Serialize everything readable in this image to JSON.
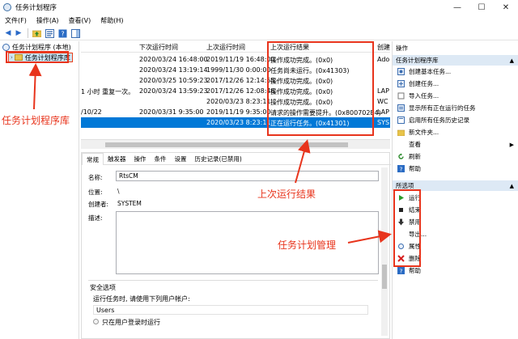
{
  "window": {
    "title": "任务计划程序",
    "controls": [
      "—",
      "☐",
      "✕"
    ]
  },
  "menu": [
    "文件(F)",
    "操作(A)",
    "查看(V)",
    "帮助(H)"
  ],
  "tree": {
    "root": "任务计划程序 (本地)",
    "child": "任务计划程序库"
  },
  "list": {
    "headers": {
      "next_run": "下次运行时间",
      "last_run": "上次运行时间",
      "last_result": "上次运行结果",
      "creator": "创建"
    },
    "rows": [
      {
        "name": "",
        "next_run": "2020/03/24 16:48:00",
        "last_run": "2019/11/19 16:48:00",
        "result": "操作成功完成。(0x0)",
        "creator": "Ado"
      },
      {
        "name": "",
        "next_run": "2020/03/24 13:19:14",
        "last_run": "1999/11/30 0:00:00",
        "result": "任务尚未运行。(0x41303)",
        "creator": ""
      },
      {
        "name": "",
        "next_run": "2020/03/25 10:59:23",
        "last_run": "2017/12/26 12:14:55",
        "result": "操作成功完成。(0x0)",
        "creator": ""
      },
      {
        "name": "1 小时 重复一次。",
        "next_run": "2020/03/24 13:59:23",
        "last_run": "2017/12/26 12:08:46",
        "result": "操作成功完成。(0x0)",
        "creator": "LAP"
      },
      {
        "name": "",
        "next_run": "",
        "last_run": "2020/03/23 8:23:11",
        "result": "操作成功完成。(0x0)",
        "creator": "WC"
      },
      {
        "name": "/10/22",
        "next_run": "2020/03/31 9:35:00",
        "last_run": "2019/11/19 9:35:00",
        "result": "请求的操作需要提升。(0x800702E4)",
        "creator": "LAP"
      },
      {
        "name": "",
        "next_run": "",
        "last_run": "2020/03/23 8:23:11",
        "result": "正在运行任务。(0x41301)",
        "creator": "SYS"
      }
    ],
    "selected_row_index": 6
  },
  "detail": {
    "tabs": [
      "常规",
      "触发器",
      "操作",
      "条件",
      "设置",
      "历史记录(已禁用)"
    ],
    "name_label": "名称:",
    "name_value": "RtsCM",
    "location_label": "位置:",
    "location_value": "\\",
    "author_label": "创建者:",
    "author_value": "SYSTEM",
    "description_label": "描述:",
    "security_title": "安全选项",
    "security_run_as": "运行任务时, 请使用下列用户帐户:",
    "security_user": "Users",
    "security_option": "只在用户登录时运行"
  },
  "actions": {
    "header": "操作",
    "library_section": "任务计划程序库",
    "library_items": [
      {
        "icon": "create-basic-task-icon",
        "label": "创建基本任务..."
      },
      {
        "icon": "create-task-icon",
        "label": "创建任务..."
      },
      {
        "icon": "import-task-icon",
        "label": "导入任务..."
      },
      {
        "icon": "show-running-icon",
        "label": "显示所有正在运行的任务"
      },
      {
        "icon": "enable-history-icon",
        "label": "启用所有任务历史记录"
      },
      {
        "icon": "new-folder-icon",
        "label": "新文件夹..."
      },
      {
        "icon": "view-icon",
        "label": "查看"
      },
      {
        "icon": "refresh-icon",
        "label": "刷新"
      },
      {
        "icon": "help-icon",
        "label": "帮助"
      }
    ],
    "selected_section": "所选项",
    "selected_items": [
      {
        "icon": "run-icon",
        "label": "运行"
      },
      {
        "icon": "end-icon",
        "label": "结束"
      },
      {
        "icon": "disable-icon",
        "label": "禁用"
      },
      {
        "icon": "export-icon",
        "label": "导出..."
      },
      {
        "icon": "properties-icon",
        "label": "属性"
      },
      {
        "icon": "delete-icon",
        "label": "删除"
      },
      {
        "icon": "help-icon",
        "label": "帮助"
      }
    ]
  },
  "annotations": {
    "library": "任务计划程序库",
    "last_result": "上次运行结果",
    "management": "任务计划管理",
    "color": "#e8341c"
  },
  "colors": {
    "selection": "#0078d7",
    "section_bar": "#dde9f5",
    "annotation": "#e8341c"
  }
}
